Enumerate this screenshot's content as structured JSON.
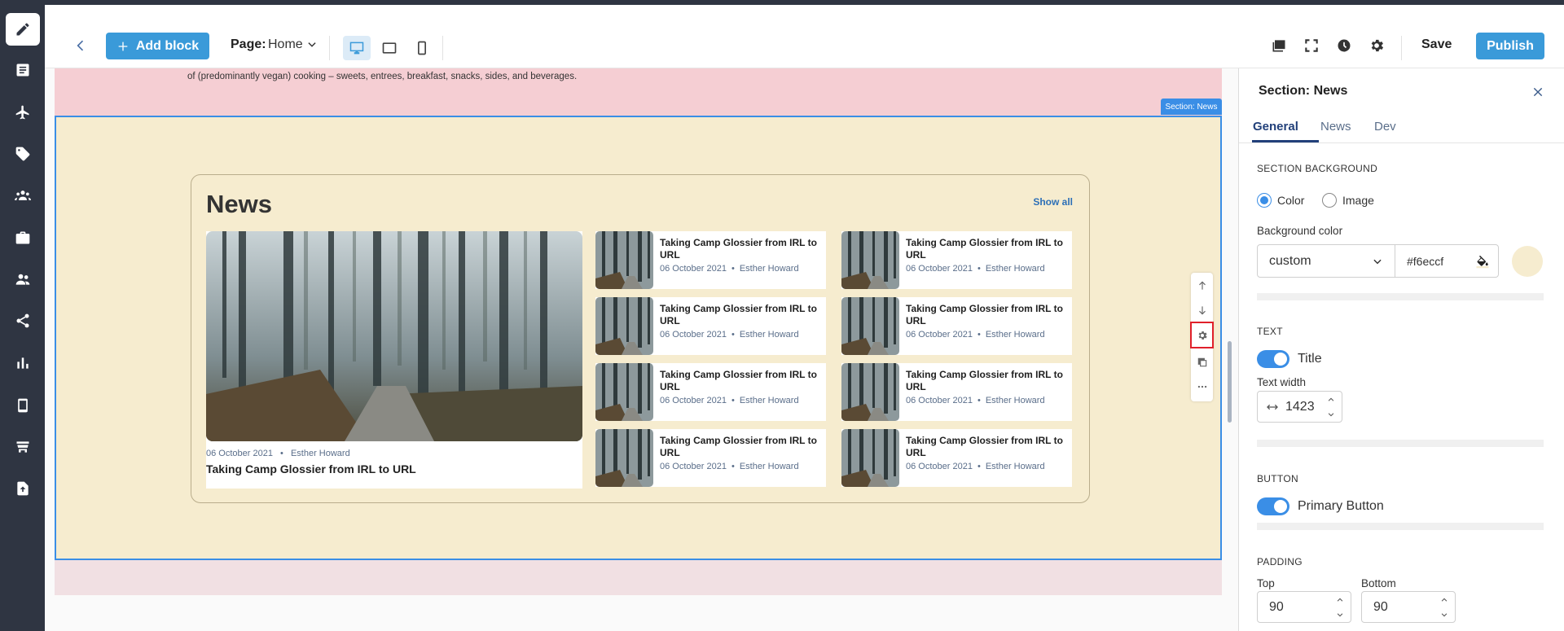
{
  "colors": {
    "rail_bg": "#2f3542",
    "accent": "#3a9ad9",
    "section_bg": "#f6eccf",
    "pink_bg": "#f5ced3",
    "selection_border": "#3a8ee6",
    "highlight": "#e0202a"
  },
  "rail": {
    "items": [
      {
        "icon": "pencil-icon"
      },
      {
        "icon": "pages-icon"
      },
      {
        "icon": "airplane-icon"
      },
      {
        "icon": "tag-icon"
      },
      {
        "icon": "group-icon"
      },
      {
        "icon": "briefcase-icon"
      },
      {
        "icon": "users-icon"
      },
      {
        "icon": "share-icon"
      },
      {
        "icon": "bar-chart-icon"
      },
      {
        "icon": "mobile-icon"
      },
      {
        "icon": "shop-icon"
      },
      {
        "icon": "upload-file-icon"
      }
    ]
  },
  "toolbar": {
    "add_block_label": "Add block",
    "page_label": "Page:",
    "page_value": "Home",
    "save_label": "Save",
    "publish_label": "Publish"
  },
  "canvas": {
    "top_text": "of (predominantly vegan) cooking – sweets, entrees, breakfast, snacks, sides, and beverages.",
    "section_tag": "Section: News",
    "news": {
      "title": "News",
      "show_all": "Show all",
      "feature": {
        "date": "06 October 2021",
        "author": "Esther Howard",
        "title": "Taking Camp Glossier from IRL to URL"
      },
      "cards": [
        {
          "title": "Taking Camp Glossier from IRL to URL",
          "date": "06 October 2021",
          "author": "Esther Howard"
        },
        {
          "title": "Taking Camp Glossier from IRL to URL",
          "date": "06 October 2021",
          "author": "Esther Howard"
        },
        {
          "title": "Taking Camp Glossier from IRL to URL",
          "date": "06 October 2021",
          "author": "Esther Howard"
        },
        {
          "title": "Taking Camp Glossier from IRL to URL",
          "date": "06 October 2021",
          "author": "Esther Howard"
        },
        {
          "title": "Taking Camp Glossier from IRL to URL",
          "date": "06 October 2021",
          "author": "Esther Howard"
        },
        {
          "title": "Taking Camp Glossier from IRL to URL",
          "date": "06 October 2021",
          "author": "Esther Howard"
        },
        {
          "title": "Taking Camp Glossier from IRL to URL",
          "date": "06 October 2021",
          "author": "Esther Howard"
        },
        {
          "title": "Taking Camp Glossier from IRL to URL",
          "date": "06 October 2021",
          "author": "Esther Howard"
        }
      ]
    },
    "meta_separator": "•"
  },
  "panel": {
    "title": "Section: News",
    "tabs": [
      "General",
      "News",
      "Dev"
    ],
    "section_background_label": "SECTION BACKGROUND",
    "radio_color": "Color",
    "radio_image": "Image",
    "background_color_label": "Background color",
    "background_select_value": "custom",
    "background_hex": "#f6eccf",
    "text_label": "TEXT",
    "title_toggle_label": "Title",
    "text_width_label": "Text width",
    "text_width_value": "1423",
    "button_label": "BUTTON",
    "primary_button_toggle_label": "Primary Button",
    "padding_label": "PADDING",
    "top_label": "Top",
    "bottom_label": "Bottom",
    "top_value": "90",
    "bottom_value": "90"
  }
}
